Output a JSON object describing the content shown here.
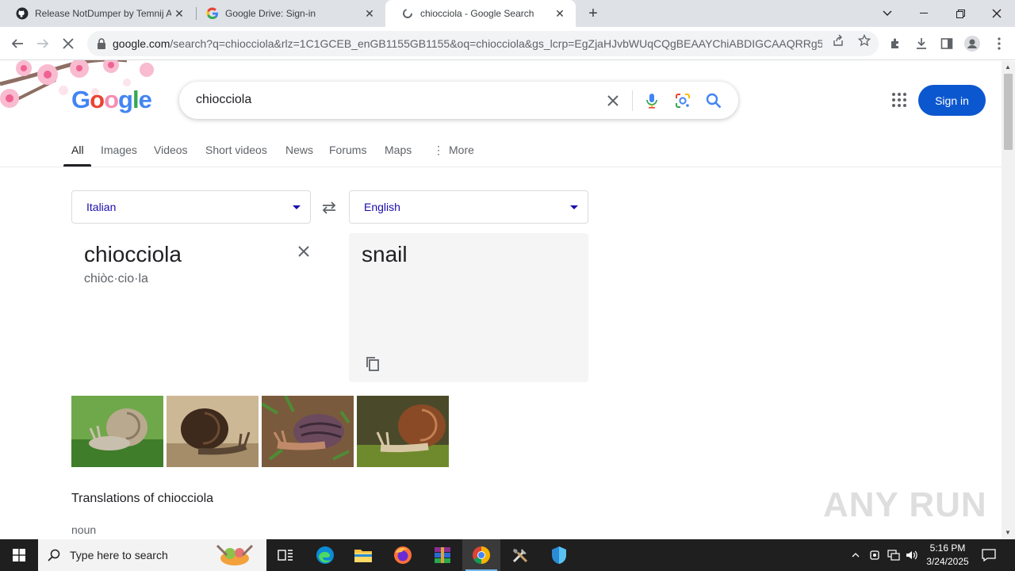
{
  "browser": {
    "tabs": [
      {
        "title": "Release NotDumper by Temnij A",
        "icon": "github-icon"
      },
      {
        "title": "Google Drive: Sign-in",
        "icon": "google-g-icon"
      },
      {
        "title": "chiocciola - Google Search",
        "icon": "loading-icon"
      }
    ],
    "url_host": "google.com",
    "url_path": "/search?q=chiocciola&rlz=1C1GCEB_enGB1155GB1155&oq=chiocciola&gs_lcrp=EgZjaHJvbWUqCQgBEAAYChiABDIGCAAQRRg5MgkI..."
  },
  "google": {
    "logo": "Google",
    "query": "chiocciola",
    "sign_in": "Sign in",
    "nav_tabs": [
      "All",
      "Images",
      "Videos",
      "Short videos",
      "News",
      "Forums",
      "Maps",
      "More"
    ]
  },
  "translate": {
    "source_lang": "Italian",
    "target_lang": "English",
    "source_text": "chiocciola",
    "phonetic": "chiòc·cio·la",
    "target_text": "snail"
  },
  "translations": {
    "title": "Translations of chiocciola",
    "pos": "noun"
  },
  "watermark": "ANY RUN",
  "taskbar": {
    "search_placeholder": "Type here to search",
    "time": "5:16 PM",
    "date": "3/24/2025"
  },
  "colors": {
    "accent_blue": "#0b57d0",
    "link_blue": "#1a0dab"
  }
}
